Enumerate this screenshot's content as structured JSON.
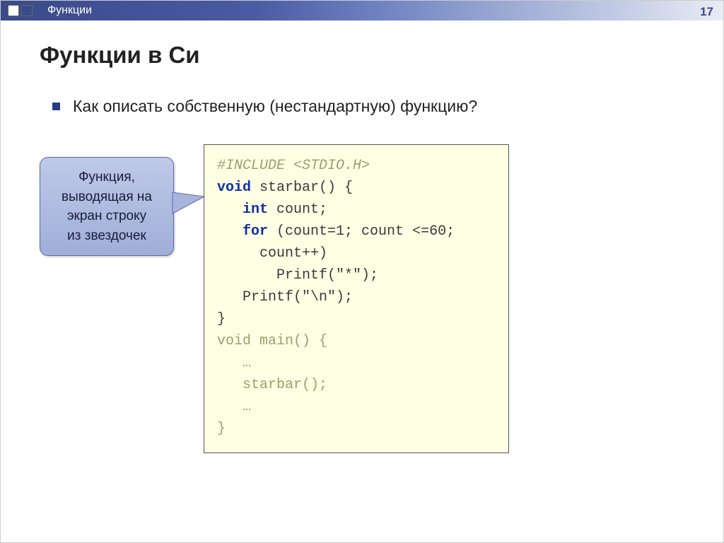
{
  "header": {
    "breadcrumb": "Функции",
    "page_number": "17"
  },
  "title": "Функции в Си",
  "bullet": "Как описать собственную (нестандартную) функцию?",
  "callout": {
    "line1": "Функция,",
    "line2": "выводящая на",
    "line3": "экран строку",
    "line4": "из звездочек"
  },
  "code": {
    "l01a": "#INCLUDE <STDIO.H>",
    "blank": "",
    "l02a": "void",
    "l02b": " starbar() {",
    "l03a": "   ",
    "l03b": "int",
    "l03c": " count;",
    "l04a": "   ",
    "l04b": "for",
    "l04c": " (count=1; count <=60;",
    "l05": "     count++)",
    "l06": "       Printf(\"*\");",
    "l07": "   Printf(\"\\n\");",
    "l08": "}",
    "l09a": "void main() {",
    "l10": "   …",
    "l11": "   starbar();",
    "l12": "   …",
    "l13": "}"
  }
}
